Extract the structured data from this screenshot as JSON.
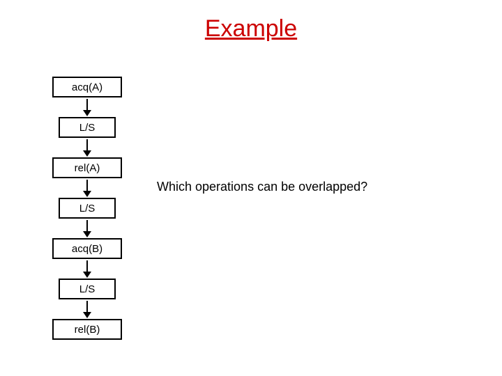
{
  "title": "Example",
  "flow": {
    "steps": [
      {
        "label": "acq(A)",
        "width": "wide"
      },
      {
        "label": "L/S",
        "width": "narrow"
      },
      {
        "label": "rel(A)",
        "width": "wide"
      },
      {
        "label": "L/S",
        "width": "narrow"
      },
      {
        "label": "acq(B)",
        "width": "wide"
      },
      {
        "label": "L/S",
        "width": "narrow"
      },
      {
        "label": "rel(B)",
        "width": "wide"
      }
    ]
  },
  "question": "Which operations can be overlapped?"
}
